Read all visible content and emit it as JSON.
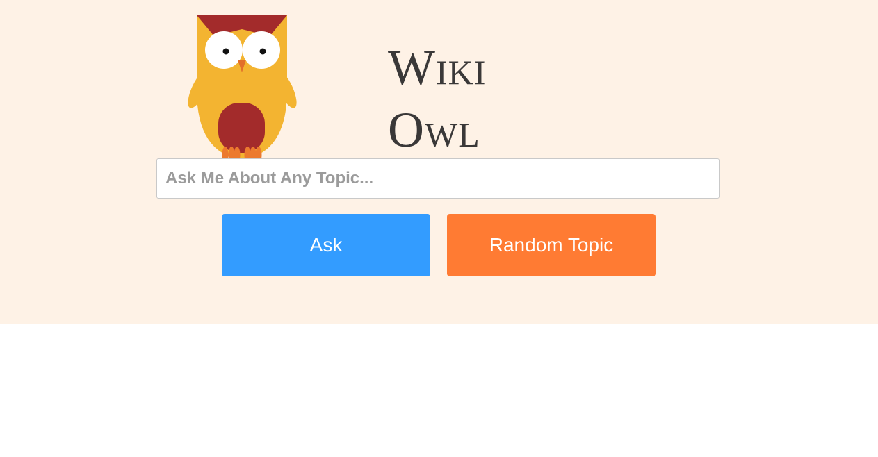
{
  "header": {
    "title_line1": "Wiki",
    "title_line2": "Owl"
  },
  "logo": {
    "icon": "owl-icon"
  },
  "search": {
    "placeholder": "Ask Me About Any Topic...",
    "value": ""
  },
  "actions": {
    "ask_label": "Ask",
    "random_label": "Random Topic"
  },
  "colors": {
    "hero_background": "#fef2e6",
    "ask_button": "#339cff",
    "random_button": "#ff7b33",
    "owl_body": "#f3b431",
    "owl_accent": "#a32b2b",
    "owl_feet": "#ec7a2e"
  }
}
